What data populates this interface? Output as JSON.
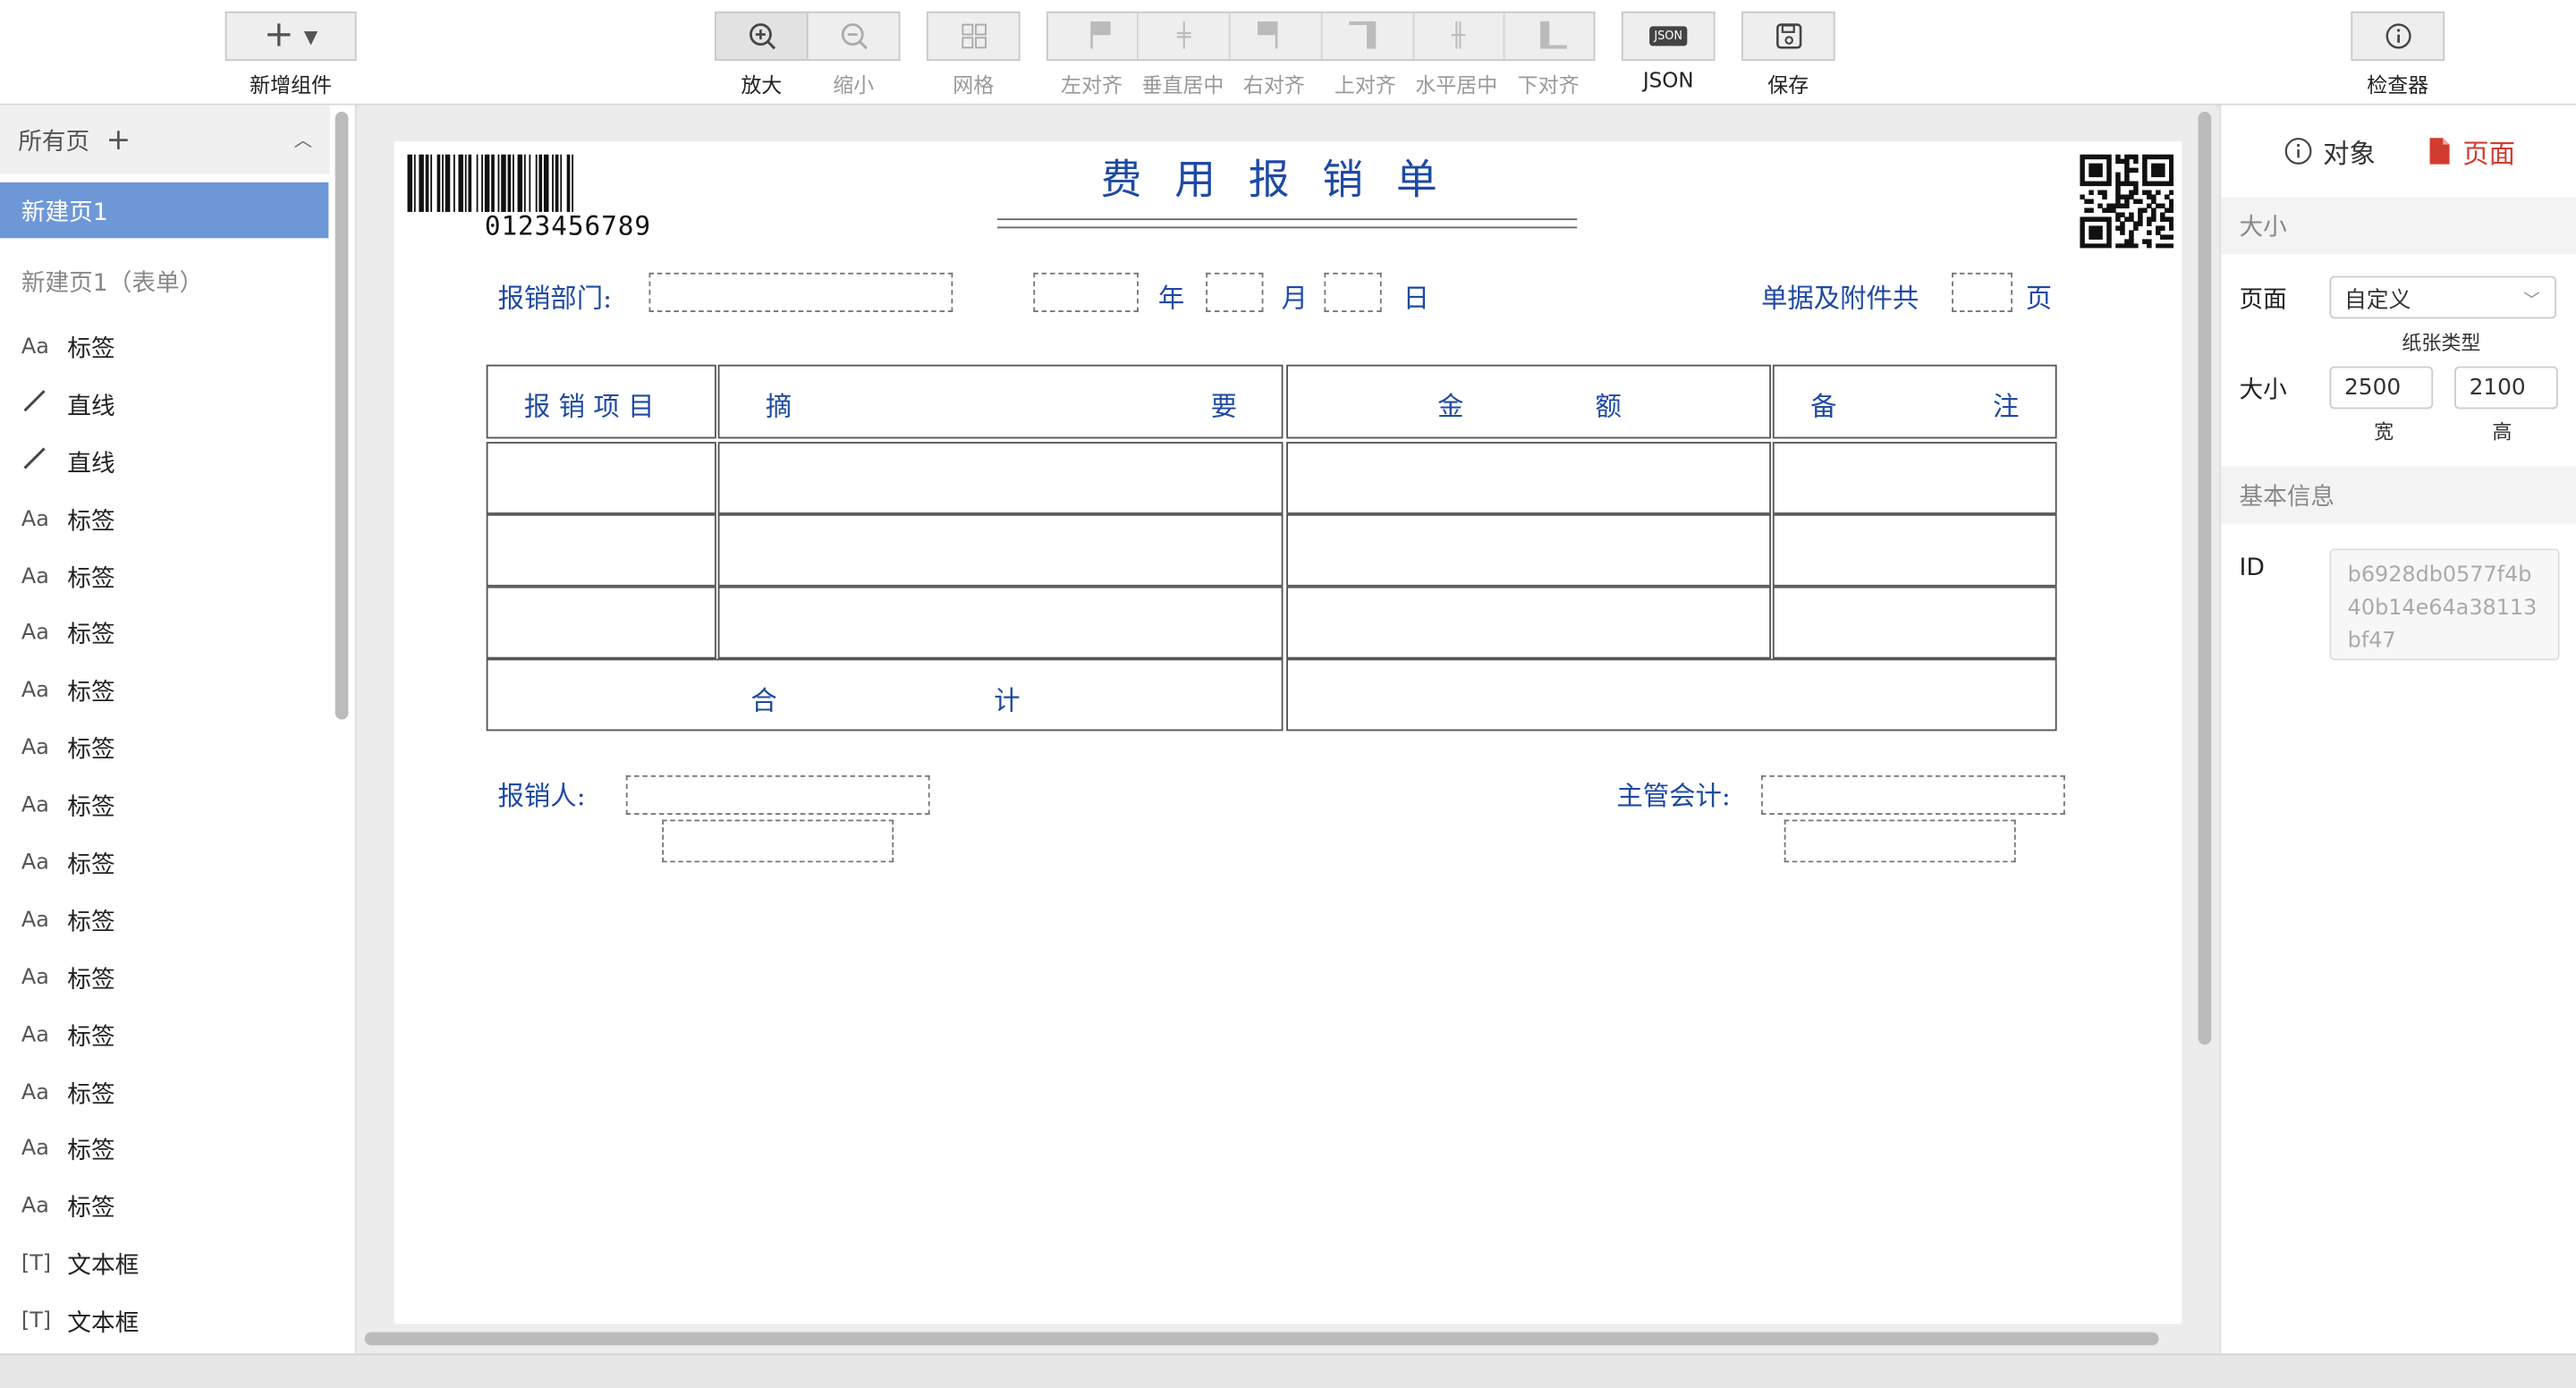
{
  "toolbar": {
    "add_component": "新增组件",
    "zoom_in": "放大",
    "zoom_out": "缩小",
    "grid": "网格",
    "align_left": "左对齐",
    "align_vcenter": "垂直居中",
    "align_right": "右对齐",
    "align_top": "上对齐",
    "align_hcenter": "水平居中",
    "align_bottom": "下对齐",
    "json_label": "JSON",
    "json_icon_text": "JSON",
    "save": "保存",
    "inspector": "检查器"
  },
  "sidebar": {
    "all_pages": "所有页",
    "pages": [
      {
        "label": "新建页1"
      },
      {
        "label": "新建页1（表单）"
      }
    ],
    "components": [
      {
        "icon": "Aa",
        "label": "标签"
      },
      {
        "icon": "line-icon",
        "label": "直线"
      },
      {
        "icon": "line-icon",
        "label": "直线"
      },
      {
        "icon": "Aa",
        "label": "标签"
      },
      {
        "icon": "Aa",
        "label": "标签"
      },
      {
        "icon": "Aa",
        "label": "标签"
      },
      {
        "icon": "Aa",
        "label": "标签"
      },
      {
        "icon": "Aa",
        "label": "标签"
      },
      {
        "icon": "Aa",
        "label": "标签"
      },
      {
        "icon": "Aa",
        "label": "标签"
      },
      {
        "icon": "Aa",
        "label": "标签"
      },
      {
        "icon": "Aa",
        "label": "标签"
      },
      {
        "icon": "Aa",
        "label": "标签"
      },
      {
        "icon": "Aa",
        "label": "标签"
      },
      {
        "icon": "Aa",
        "label": "标签"
      },
      {
        "icon": "Aa",
        "label": "标签"
      },
      {
        "icon": "[T]",
        "label": "文本框"
      },
      {
        "icon": "[T]",
        "label": "文本框"
      }
    ]
  },
  "form": {
    "barcode_number": "0123456789",
    "title": "费 用 报 销 单",
    "dept_label": "报销部门:",
    "year": "年",
    "month": "月",
    "day": "日",
    "attach_label": "单据及附件共",
    "page_unit": "页",
    "headers": [
      "报 销 项 目",
      "摘",
      "要",
      "金",
      "额",
      "备",
      "注"
    ],
    "total_left": "合",
    "total_right": "计",
    "claimant_label": "报销人:",
    "accountant_label": "主管会计:"
  },
  "inspector": {
    "tab_object": "对象",
    "tab_page": "页面",
    "section_size": "大小",
    "page_label": "页面",
    "paper_type_value": "自定义",
    "paper_type_caption": "纸张类型",
    "size_label": "大小",
    "width_value": "2500",
    "height_value": "2100",
    "width_caption": "宽",
    "height_caption": "高",
    "section_basic": "基本信息",
    "id_label": "ID",
    "id_value": "b6928db0577f4b40b14e64a38113bf47"
  },
  "colors": {
    "accent_blue": "#6e97d8",
    "form_text": "#1e4aa3",
    "page_tab_red": "#d23c2f"
  }
}
